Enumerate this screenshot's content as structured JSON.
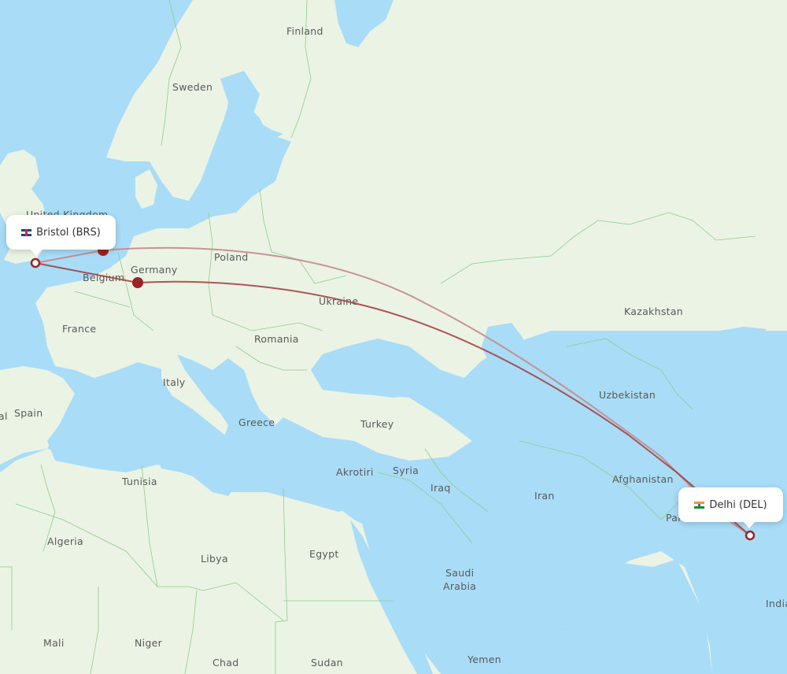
{
  "map": {
    "colors": {
      "water": "#a8dcf7",
      "land": "#eaf3e4",
      "border": "#8ccf8a",
      "route_primary": "#a23a3a",
      "route_secondary": "#c48a8a",
      "stop_marker": "#9b2226"
    },
    "origin": {
      "city": "Bristol",
      "code": "BRS",
      "label": "Bristol (BRS)",
      "flag": "uk-flag"
    },
    "destination": {
      "city": "Delhi",
      "code": "DEL",
      "label": "Delhi (DEL)",
      "flag": "india-flag"
    },
    "routes": [
      {
        "name": "via-amsterdam",
        "stop": "Amsterdam area"
      },
      {
        "name": "via-frankfurt",
        "stop": "Frankfurt area"
      }
    ],
    "labels": {
      "finland": "Finland",
      "sweden": "Sweden",
      "united_kingdom": "United Kingdom",
      "poland": "Poland",
      "germany": "Germany",
      "belgium": "Belgium",
      "ukraine": "Ukraine",
      "france": "France",
      "romania": "Romania",
      "kazakhstan": "Kazakhstan",
      "italy": "Italy",
      "spain": "Spain",
      "portugal": "al",
      "uzbekistan": "Uzbekistan",
      "turkey": "Turkey",
      "greece": "Greece",
      "afghanistan": "Afghanistan",
      "tunisia": "Tunisia",
      "akrotiri": "Akrotiri",
      "syria": "Syria",
      "iraq": "Iraq",
      "iran": "Iran",
      "pakistan": "Pak",
      "algeria": "Algeria",
      "libya": "Libya",
      "egypt": "Egypt",
      "saudi_1": "Saudi",
      "saudi_2": "Arabia",
      "india": "India",
      "mali": "Mali",
      "niger": "Niger",
      "chad": "Chad",
      "sudan": "Sudan",
      "yemen": "Yemen"
    }
  }
}
